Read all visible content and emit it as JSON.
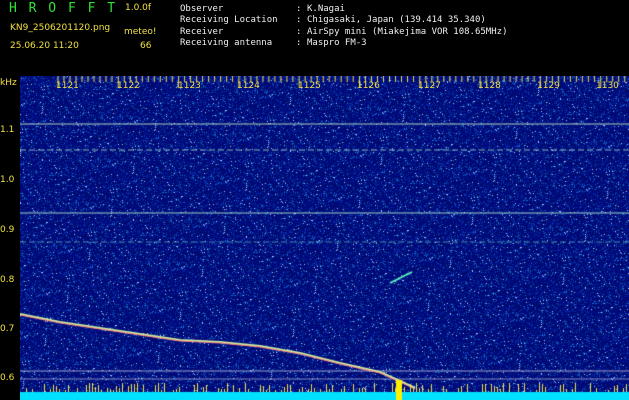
{
  "header": {
    "logo": "H R O F F T",
    "version": "1.0.0f",
    "filename": "KN9_2506201120.png",
    "timestamp": "25.06.20 11:20",
    "meteor_label": "meteo!",
    "meteor_count": "66",
    "info": [
      {
        "label": "Observer",
        "sep": ":",
        "value": "K.Nagai"
      },
      {
        "label": "Receiving Location",
        "sep": ":",
        "value": "Chigasaki, Japan (139.414 35.340)"
      },
      {
        "label": "Receiver",
        "sep": ":",
        "value": "AirSpy mini (Miakejima VOR 108.65MHz)"
      },
      {
        "label": "Receiving antenna",
        "sep": ":",
        "value": "Maspro FM-3"
      }
    ]
  },
  "y_unit": "kHz",
  "y_ticks": [
    "1.1",
    "1.0",
    "0.9",
    "0.8",
    "0.7",
    "0.6"
  ],
  "x_ticks": [
    "1121",
    "1122",
    "1123",
    "1124",
    "1125",
    "1126",
    "1127",
    "1128",
    "1129",
    "1130"
  ],
  "colors": {
    "background_noise": "#000a6e",
    "trace": "#b8e8c8",
    "label": "#f0e040",
    "logo": "#35e035",
    "baseline": "#00e0ff"
  }
}
